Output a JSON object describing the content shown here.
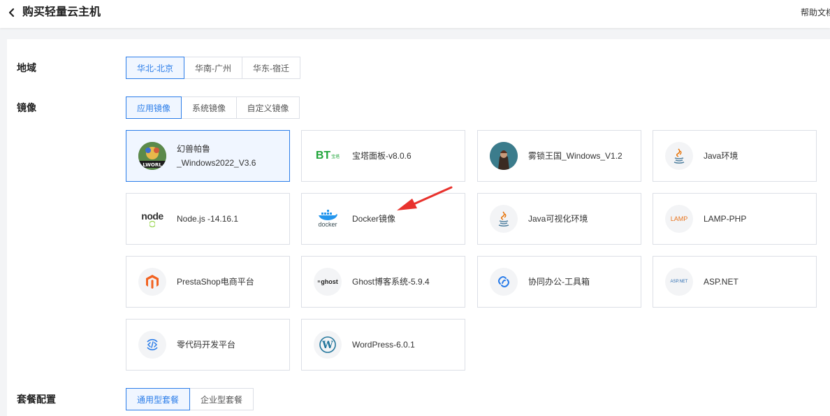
{
  "header": {
    "title": "购买轻量云主机",
    "help_link": "帮助文档"
  },
  "region": {
    "label": "地域",
    "options": [
      "华北-北京",
      "华南-广州",
      "华东-宿迁"
    ],
    "selected": "华北-北京"
  },
  "image": {
    "label": "镜像",
    "tabs": [
      "应用镜像",
      "系统镜像",
      "自定义镜像"
    ],
    "selected_tab": "应用镜像",
    "cards": [
      {
        "name_line1": "幻兽帕鲁",
        "name_line2": "_Windows2022_V3.6",
        "icon": "palworld-logo",
        "selected": true
      },
      {
        "name": "宝塔面板-v8.0.6",
        "icon": "bt-panel-logo",
        "logo_text": "BT",
        "logo_sub": "宝塔"
      },
      {
        "name": "雾锁王国_Windows_V1.2",
        "icon": "enshrouded-logo"
      },
      {
        "name": "Java环境",
        "icon": "java-logo"
      },
      {
        "name": "Node.js -14.16.1",
        "icon": "nodejs-logo",
        "logo_text": "node"
      },
      {
        "name": "Docker镜像",
        "icon": "docker-logo",
        "logo_text": "docker"
      },
      {
        "name": "Java可视化环境",
        "icon": "java-logo"
      },
      {
        "name": "LAMP-PHP",
        "icon": "lamp-logo",
        "logo_text": "LAMP"
      },
      {
        "name": "PrestaShop电商平台",
        "icon": "magento-logo"
      },
      {
        "name": "Ghost博客系统-5.9.4",
        "icon": "ghost-logo",
        "logo_text": "ghost"
      },
      {
        "name": "协同办公-工具箱",
        "icon": "link-logo"
      },
      {
        "name": "ASP.NET",
        "icon": "aspnet-logo",
        "logo_text": "ASP.NET"
      },
      {
        "name": "零代码开发平台",
        "icon": "code-logo"
      },
      {
        "name": "WordPress-6.0.1",
        "icon": "wordpress-logo"
      }
    ]
  },
  "plan": {
    "label": "套餐配置",
    "tabs": [
      "通用型套餐",
      "企业型套餐"
    ],
    "selected_tab": "通用型套餐"
  },
  "colors": {
    "accent": "#2b7de9",
    "annotation_arrow": "#e8322d"
  }
}
